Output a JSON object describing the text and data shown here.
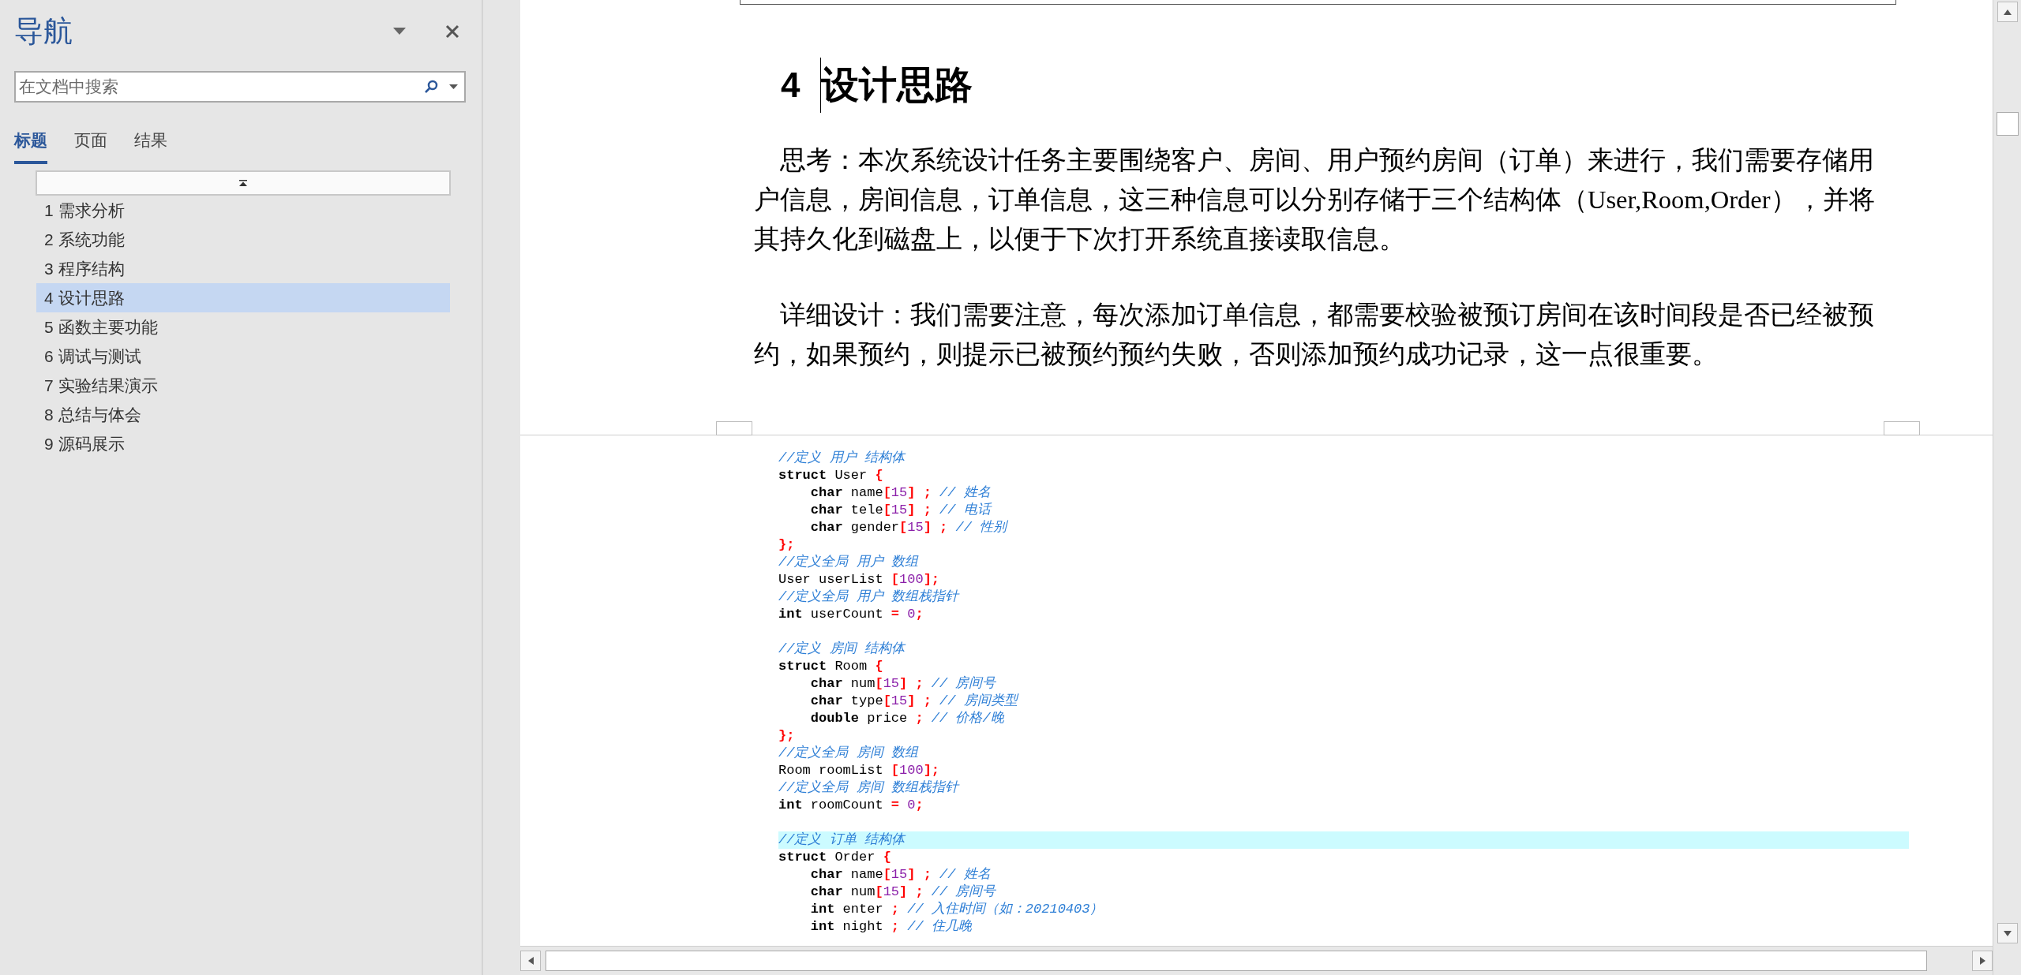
{
  "nav": {
    "title": "导航",
    "search": {
      "placeholder": "在文档中搜索"
    },
    "tabs": [
      {
        "label": "标题",
        "selected": true
      },
      {
        "label": "页面",
        "selected": false
      },
      {
        "label": "结果",
        "selected": false
      }
    ],
    "headings": [
      {
        "label": "1 需求分析",
        "selected": false
      },
      {
        "label": "2 系统功能",
        "selected": false
      },
      {
        "label": "3 程序结构",
        "selected": false
      },
      {
        "label": "4 设计思路",
        "selected": true
      },
      {
        "label": "5 函数主要功能",
        "selected": false
      },
      {
        "label": "6 调试与测试",
        "selected": false
      },
      {
        "label": "7 实验结果演示",
        "selected": false
      },
      {
        "label": "8 总结与体会",
        "selected": false
      },
      {
        "label": "9 源码展示",
        "selected": false
      }
    ]
  },
  "document": {
    "heading": {
      "number": "4",
      "title": "设计思路"
    },
    "paragraphs": [
      "思考：本次系统设计任务主要围绕客户、房间、用户预约房间（订单）来进行，我们需要存储用户信息，房间信息，订单信息，这三种信息可以分别存储于三个结构体（User,Room,Order），并将其持久化到磁盘上，以便于下次打开系统直接读取信息。",
      "详细设计：我们需要注意，每次添加订单信息，都需要校验被预订房间在该时间段是否已经被预约，如果预约，则提示已被预约预约失败，否则添加预约成功记录，这一点很重要。"
    ],
    "code_blocks": [
      {
        "lines": [
          {
            "highlighted": false,
            "tokens": [
              {
                "kind": "comment",
                "text": "//定义 用户 结构体"
              }
            ]
          },
          {
            "highlighted": false,
            "tokens": [
              {
                "kind": "keyword",
                "text": "struct"
              },
              {
                "kind": "plain",
                "text": " User "
              },
              {
                "kind": "punct",
                "text": "{"
              }
            ]
          },
          {
            "highlighted": false,
            "tokens": [
              {
                "kind": "keyword",
                "text": "    char"
              },
              {
                "kind": "plain",
                "text": " name"
              },
              {
                "kind": "punct",
                "text": "["
              },
              {
                "kind": "number",
                "text": "15"
              },
              {
                "kind": "punct",
                "text": "] ;"
              },
              {
                "kind": "comment",
                "text": " // 姓名"
              }
            ]
          },
          {
            "highlighted": false,
            "tokens": [
              {
                "kind": "keyword",
                "text": "    char"
              },
              {
                "kind": "plain",
                "text": " tele"
              },
              {
                "kind": "punct",
                "text": "["
              },
              {
                "kind": "number",
                "text": "15"
              },
              {
                "kind": "punct",
                "text": "] ;"
              },
              {
                "kind": "comment",
                "text": " // 电话"
              }
            ]
          },
          {
            "highlighted": false,
            "tokens": [
              {
                "kind": "keyword",
                "text": "    char"
              },
              {
                "kind": "plain",
                "text": " gender"
              },
              {
                "kind": "punct",
                "text": "["
              },
              {
                "kind": "number",
                "text": "15"
              },
              {
                "kind": "punct",
                "text": "] ;"
              },
              {
                "kind": "comment",
                "text": " // 性别"
              }
            ]
          },
          {
            "highlighted": false,
            "tokens": [
              {
                "kind": "punct",
                "text": "};"
              }
            ]
          },
          {
            "highlighted": false,
            "tokens": [
              {
                "kind": "comment",
                "text": "//定义全局 用户 数组"
              }
            ]
          },
          {
            "highlighted": false,
            "tokens": [
              {
                "kind": "plain",
                "text": "User userList "
              },
              {
                "kind": "punct",
                "text": "["
              },
              {
                "kind": "number",
                "text": "100"
              },
              {
                "kind": "punct",
                "text": "];"
              }
            ]
          },
          {
            "highlighted": false,
            "tokens": [
              {
                "kind": "comment",
                "text": "//定义全局 用户 数组栈指针"
              }
            ]
          },
          {
            "highlighted": false,
            "tokens": [
              {
                "kind": "keyword",
                "text": "int"
              },
              {
                "kind": "plain",
                "text": " userCount "
              },
              {
                "kind": "punct",
                "text": "="
              },
              {
                "kind": "number",
                "text": " 0"
              },
              {
                "kind": "punct",
                "text": ";"
              }
            ]
          }
        ]
      },
      {
        "lines": [
          {
            "highlighted": false,
            "tokens": [
              {
                "kind": "comment",
                "text": "//定义 房间 结构体"
              }
            ]
          },
          {
            "highlighted": false,
            "tokens": [
              {
                "kind": "keyword",
                "text": "struct"
              },
              {
                "kind": "plain",
                "text": " Room "
              },
              {
                "kind": "punct",
                "text": "{"
              }
            ]
          },
          {
            "highlighted": false,
            "tokens": [
              {
                "kind": "keyword",
                "text": "    char"
              },
              {
                "kind": "plain",
                "text": " num"
              },
              {
                "kind": "punct",
                "text": "["
              },
              {
                "kind": "number",
                "text": "15"
              },
              {
                "kind": "punct",
                "text": "] ;"
              },
              {
                "kind": "comment",
                "text": " // 房间号"
              }
            ]
          },
          {
            "highlighted": false,
            "tokens": [
              {
                "kind": "keyword",
                "text": "    char"
              },
              {
                "kind": "plain",
                "text": " type"
              },
              {
                "kind": "punct",
                "text": "["
              },
              {
                "kind": "number",
                "text": "15"
              },
              {
                "kind": "punct",
                "text": "] ;"
              },
              {
                "kind": "comment",
                "text": " // 房间类型"
              }
            ]
          },
          {
            "highlighted": false,
            "tokens": [
              {
                "kind": "keyword",
                "text": "    double"
              },
              {
                "kind": "plain",
                "text": " price "
              },
              {
                "kind": "punct",
                "text": ";"
              },
              {
                "kind": "comment",
                "text": " // 价格/晚"
              }
            ]
          },
          {
            "highlighted": false,
            "tokens": [
              {
                "kind": "punct",
                "text": "};"
              }
            ]
          },
          {
            "highlighted": false,
            "tokens": [
              {
                "kind": "comment",
                "text": "//定义全局 房间 数组"
              }
            ]
          },
          {
            "highlighted": false,
            "tokens": [
              {
                "kind": "plain",
                "text": "Room roomList "
              },
              {
                "kind": "punct",
                "text": "["
              },
              {
                "kind": "number",
                "text": "100"
              },
              {
                "kind": "punct",
                "text": "];"
              }
            ]
          },
          {
            "highlighted": false,
            "tokens": [
              {
                "kind": "comment",
                "text": "//定义全局 房间 数组栈指针"
              }
            ]
          },
          {
            "highlighted": false,
            "tokens": [
              {
                "kind": "keyword",
                "text": "int"
              },
              {
                "kind": "plain",
                "text": " roomCount "
              },
              {
                "kind": "punct",
                "text": "="
              },
              {
                "kind": "number",
                "text": " 0"
              },
              {
                "kind": "punct",
                "text": ";"
              }
            ]
          }
        ]
      },
      {
        "lines": [
          {
            "highlighted": true,
            "tokens": [
              {
                "kind": "comment",
                "text": "//定义 订单 结构体"
              }
            ]
          },
          {
            "highlighted": false,
            "tokens": [
              {
                "kind": "keyword",
                "text": "struct"
              },
              {
                "kind": "plain",
                "text": " Order "
              },
              {
                "kind": "punct",
                "text": "{"
              }
            ]
          },
          {
            "highlighted": false,
            "tokens": [
              {
                "kind": "keyword",
                "text": "    char"
              },
              {
                "kind": "plain",
                "text": " name"
              },
              {
                "kind": "punct",
                "text": "["
              },
              {
                "kind": "number",
                "text": "15"
              },
              {
                "kind": "punct",
                "text": "] ;"
              },
              {
                "kind": "comment",
                "text": " // 姓名"
              }
            ]
          },
          {
            "highlighted": false,
            "tokens": [
              {
                "kind": "keyword",
                "text": "    char"
              },
              {
                "kind": "plain",
                "text": " num"
              },
              {
                "kind": "punct",
                "text": "["
              },
              {
                "kind": "number",
                "text": "15"
              },
              {
                "kind": "punct",
                "text": "] ;"
              },
              {
                "kind": "comment",
                "text": " // 房间号"
              }
            ]
          },
          {
            "highlighted": false,
            "tokens": [
              {
                "kind": "keyword",
                "text": "    int"
              },
              {
                "kind": "plain",
                "text": " enter "
              },
              {
                "kind": "punct",
                "text": ";"
              },
              {
                "kind": "comment",
                "text": " // 入住时间（如：20210403）"
              }
            ]
          },
          {
            "highlighted": false,
            "tokens": [
              {
                "kind": "keyword",
                "text": "    int"
              },
              {
                "kind": "plain",
                "text": " night "
              },
              {
                "kind": "punct",
                "text": ";"
              },
              {
                "kind": "comment",
                "text": " // 住几晚"
              }
            ]
          }
        ]
      }
    ]
  }
}
